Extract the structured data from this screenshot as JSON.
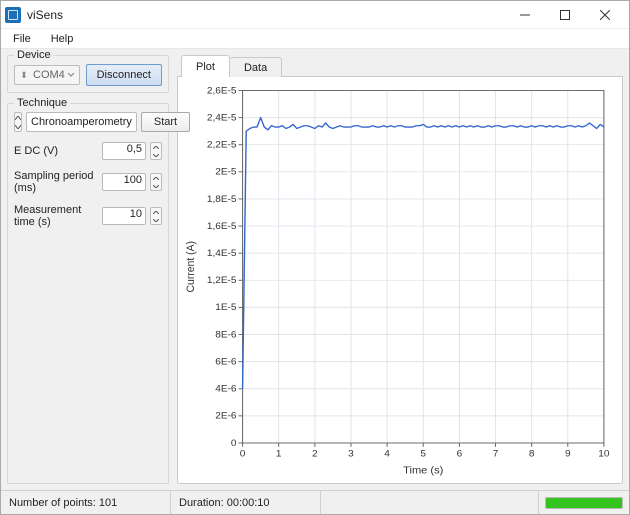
{
  "window": {
    "title": "viSens"
  },
  "menu": {
    "file": "File",
    "help": "Help"
  },
  "device": {
    "legend": "Device",
    "port": "COM4",
    "disconnect_label": "Disconnect"
  },
  "technique": {
    "legend": "Technique",
    "name": "Chronoamperometry",
    "start_label": "Start",
    "params": {
      "edc": {
        "label": "E DC (V)",
        "value": "0,5"
      },
      "samp": {
        "label": "Sampling period (ms)",
        "value": "100"
      },
      "meas": {
        "label": "Measurement time (s)",
        "value": "10"
      }
    }
  },
  "tabs": {
    "plot": "Plot",
    "data": "Data"
  },
  "status": {
    "points_label": "Number of points:",
    "points_value": "101",
    "duration_label": "Duration:",
    "duration_value": "00:00:10",
    "progress_pct": 100
  },
  "chart_data": {
    "type": "line",
    "title": "",
    "xlabel": "Time (s)",
    "ylabel": "Current (A)",
    "xlim": [
      0,
      10
    ],
    "ylim": [
      0,
      2.6e-05
    ],
    "xticks": [
      0,
      1,
      2,
      3,
      4,
      5,
      6,
      7,
      8,
      9,
      10
    ],
    "yticks": [
      0,
      2e-06,
      4e-06,
      6e-06,
      8e-06,
      1e-05,
      1.2e-05,
      1.4e-05,
      1.6e-05,
      1.8e-05,
      2e-05,
      2.2e-05,
      2.4e-05,
      2.6e-05
    ],
    "ytick_labels": [
      "0",
      "2E-6",
      "4E-6",
      "6E-6",
      "8E-6",
      "1E-5",
      "1,2E-5",
      "1,4E-5",
      "1,6E-5",
      "1,8E-5",
      "2E-5",
      "2,2E-5",
      "2,4E-5",
      "2,6E-5"
    ],
    "series": [
      {
        "name": "Current",
        "color": "#3366cc",
        "x": [
          0.0,
          0.1,
          0.2,
          0.3,
          0.4,
          0.5,
          0.6,
          0.7,
          0.8,
          0.9,
          1.0,
          1.1,
          1.2,
          1.3,
          1.4,
          1.5,
          1.6,
          1.7,
          1.8,
          1.9,
          2.0,
          2.1,
          2.2,
          2.3,
          2.4,
          2.5,
          2.6,
          2.7,
          2.8,
          2.9,
          3.0,
          3.1,
          3.2,
          3.3,
          3.4,
          3.5,
          3.6,
          3.7,
          3.8,
          3.9,
          4.0,
          4.1,
          4.2,
          4.3,
          4.4,
          4.5,
          4.6,
          4.7,
          4.8,
          4.9,
          5.0,
          5.1,
          5.2,
          5.3,
          5.4,
          5.5,
          5.6,
          5.7,
          5.8,
          5.9,
          6.0,
          6.1,
          6.2,
          6.3,
          6.4,
          6.5,
          6.6,
          6.7,
          6.8,
          6.9,
          7.0,
          7.1,
          7.2,
          7.3,
          7.4,
          7.5,
          7.6,
          7.7,
          7.8,
          7.9,
          8.0,
          8.1,
          8.2,
          8.3,
          8.4,
          8.5,
          8.6,
          8.7,
          8.8,
          8.9,
          9.0,
          9.1,
          9.2,
          9.3,
          9.4,
          9.5,
          9.6,
          9.7,
          9.8,
          9.9,
          10.0
        ],
        "y": [
          4e-06,
          2.3e-05,
          2.32e-05,
          2.33e-05,
          2.33e-05,
          2.4e-05,
          2.33e-05,
          2.31e-05,
          2.34e-05,
          2.33e-05,
          2.33e-05,
          2.34e-05,
          2.32e-05,
          2.33e-05,
          2.35e-05,
          2.32e-05,
          2.33e-05,
          2.34e-05,
          2.34e-05,
          2.33e-05,
          2.32e-05,
          2.34e-05,
          2.33e-05,
          2.36e-05,
          2.33e-05,
          2.32e-05,
          2.33e-05,
          2.34e-05,
          2.33e-05,
          2.33e-05,
          2.33e-05,
          2.34e-05,
          2.34e-05,
          2.33e-05,
          2.33e-05,
          2.33e-05,
          2.34e-05,
          2.33e-05,
          2.33e-05,
          2.34e-05,
          2.33e-05,
          2.34e-05,
          2.33e-05,
          2.34e-05,
          2.34e-05,
          2.33e-05,
          2.33e-05,
          2.33e-05,
          2.34e-05,
          2.34e-05,
          2.35e-05,
          2.33e-05,
          2.33e-05,
          2.34e-05,
          2.33e-05,
          2.34e-05,
          2.33e-05,
          2.34e-05,
          2.33e-05,
          2.34e-05,
          2.33e-05,
          2.34e-05,
          2.33e-05,
          2.34e-05,
          2.33e-05,
          2.34e-05,
          2.33e-05,
          2.33e-05,
          2.34e-05,
          2.33e-05,
          2.34e-05,
          2.34e-05,
          2.33e-05,
          2.33e-05,
          2.34e-05,
          2.34e-05,
          2.33e-05,
          2.34e-05,
          2.33e-05,
          2.33e-05,
          2.34e-05,
          2.33e-05,
          2.34e-05,
          2.34e-05,
          2.33e-05,
          2.34e-05,
          2.33e-05,
          2.34e-05,
          2.33e-05,
          2.33e-05,
          2.34e-05,
          2.34e-05,
          2.33e-05,
          2.34e-05,
          2.33e-05,
          2.34e-05,
          2.36e-05,
          2.34e-05,
          2.32e-05,
          2.35e-05,
          2.33e-05
        ]
      }
    ]
  }
}
